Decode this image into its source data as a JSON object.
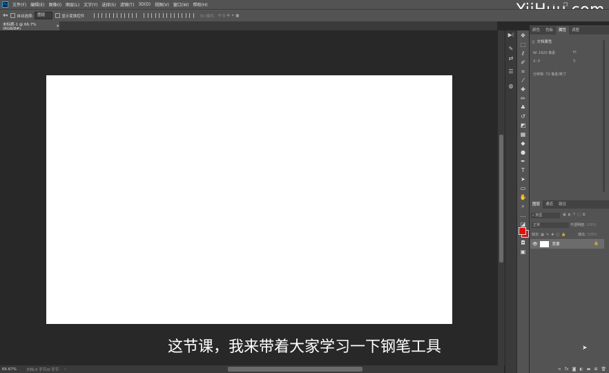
{
  "app": {
    "logo": "Ps"
  },
  "menu": [
    "文件(F)",
    "编辑(E)",
    "图像(I)",
    "图层(L)",
    "文字(Y)",
    "选择(S)",
    "滤镜(T)",
    "3D(D)",
    "视图(V)",
    "窗口(W)",
    "帮助(H)"
  ],
  "watermark": "YiiHuu.com",
  "options": {
    "auto_select_label": "自动选择:",
    "auto_select_value": "图层",
    "transform_controls_label": "显示变换控件",
    "mode_label": "3D 模式:"
  },
  "document": {
    "tab_title": "未标题-1 @ 66.7%(RGB/8#)",
    "close": "×"
  },
  "status": {
    "zoom": "66.67%",
    "doc_info": "文档:0 字节/0 字节"
  },
  "subtitle": "这节课，我来带着大家学习一下钢笔工具",
  "properties_panel": {
    "tabs": [
      "颜色",
      "色板",
      "属性",
      "调整"
    ],
    "active_tab": "属性",
    "section_title": "文档属性",
    "w_label": "W:",
    "w_value": "1920 像素",
    "h_label": "H:",
    "x_label": "X:",
    "x_value": "0",
    "y_label": "Y:",
    "resolution": "分辨率: 72 像素/英寸"
  },
  "layers_panel": {
    "tabs": [
      "图层",
      "通道",
      "路径"
    ],
    "active_tab": "图层",
    "filter_kind": "类型",
    "blend_mode": "正常",
    "opacity_label": "不透明度:",
    "opacity_value": "100%",
    "lock_label": "锁定:",
    "fill_label": "填充:",
    "fill_value": "100%",
    "layers": [
      {
        "name": "背景",
        "visible": true,
        "locked": true
      }
    ],
    "footer_icons": [
      "link-icon",
      "fx-icon",
      "mask-icon",
      "adjustment-icon",
      "folder-icon",
      "new-layer-icon",
      "trash-icon"
    ]
  },
  "colors": {
    "foreground": "#e01010",
    "background": "#c81a1a",
    "canvas": "#ffffff"
  }
}
